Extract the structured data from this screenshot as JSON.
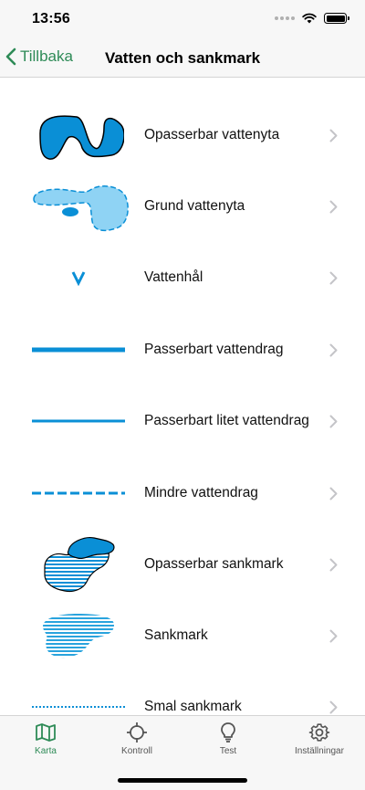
{
  "status_bar": {
    "time": "13:56"
  },
  "nav": {
    "back_label": "Tillbaka",
    "title": "Vatten och sankmark"
  },
  "items": [
    {
      "label": "Opasserbar vattenyta",
      "symbol": "impassable-water-area-icon"
    },
    {
      "label": "Grund vattenyta",
      "symbol": "shallow-water-area-icon"
    },
    {
      "label": "Vattenhål",
      "symbol": "water-hole-icon"
    },
    {
      "label": "Passerbart vattendrag",
      "symbol": "passable-watercourse-icon"
    },
    {
      "label": "Passerbart litet vattendrag",
      "symbol": "small-passable-watercourse-icon"
    },
    {
      "label": "Mindre vattendrag",
      "symbol": "minor-watercourse-icon"
    },
    {
      "label": "Opasserbar sankmark",
      "symbol": "impassable-marsh-icon"
    },
    {
      "label": "Sankmark",
      "symbol": "marsh-icon"
    },
    {
      "label": "Smal sankmark",
      "symbol": "narrow-marsh-icon"
    }
  ],
  "tabs": [
    {
      "label": "Karta",
      "icon": "map-icon",
      "active": true
    },
    {
      "label": "Kontroll",
      "icon": "crosshair-icon",
      "active": false
    },
    {
      "label": "Test",
      "icon": "lightbulb-icon",
      "active": false
    },
    {
      "label": "Inställningar",
      "icon": "gear-icon",
      "active": false
    }
  ],
  "colors": {
    "accent": "#2e8b57",
    "water_dark": "#0a8fd6",
    "water_light": "#8fd3f4",
    "chevron": "#c4c4c8"
  }
}
